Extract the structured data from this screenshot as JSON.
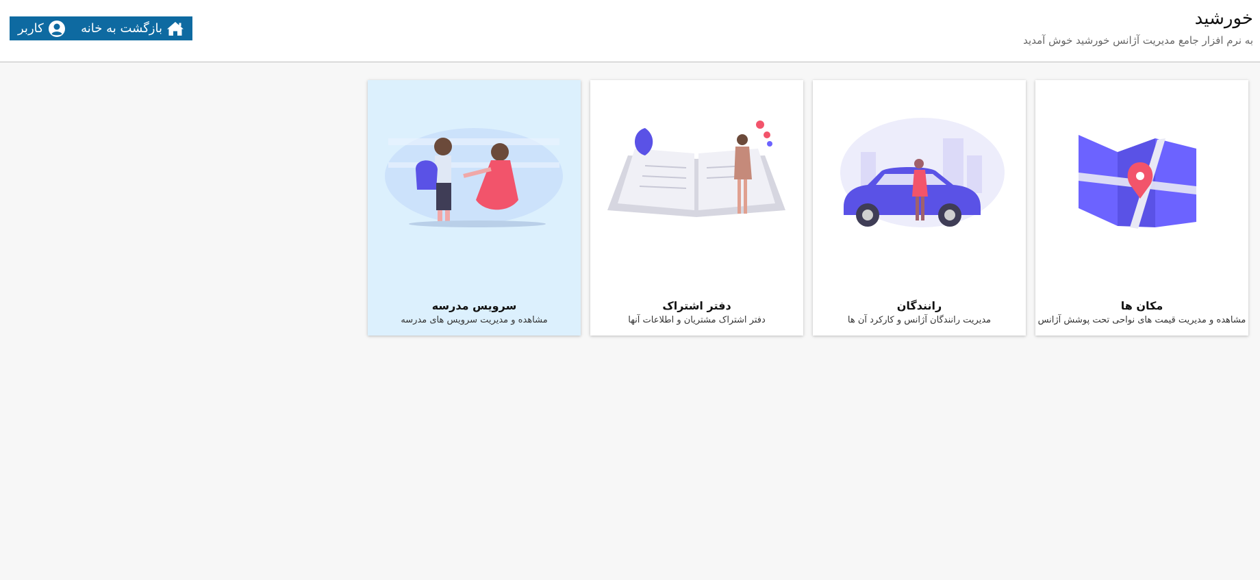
{
  "header": {
    "title": "خورشید",
    "subtitle": "به نرم افزار جامع مدیریت آژانس خورشید خوش آمدید"
  },
  "toolbar": {
    "home_label": "بازگشت به خانه",
    "home_icon": "home-icon",
    "user_label": "کاربر",
    "user_icon": "user-circle-icon",
    "color": "#0e6aa1"
  },
  "cards": [
    {
      "title": "مکان ها",
      "description": "مشاهده و مدیریت قیمت های نواحی تحت پوشش آژانس",
      "illustration": "map-pin-illustration"
    },
    {
      "title": "رانندگان",
      "description": "مدیریت رانندگان آژانس و کارکرد آن ها",
      "illustration": "car-driver-illustration"
    },
    {
      "title": "دفتر اشتراک",
      "description": "دفتر اشتراک مشتریان و اطلاعات آنها",
      "illustration": "open-book-illustration"
    },
    {
      "title": "سرویس مدرسه",
      "description": "مشاهده و مدیریت سرویس های مدرسه",
      "illustration": "school-child-illustration",
      "active": true
    }
  ],
  "colors": {
    "accent": "#6c63ff",
    "pink": "#f2546b",
    "active_card": "#dcf0fd"
  }
}
